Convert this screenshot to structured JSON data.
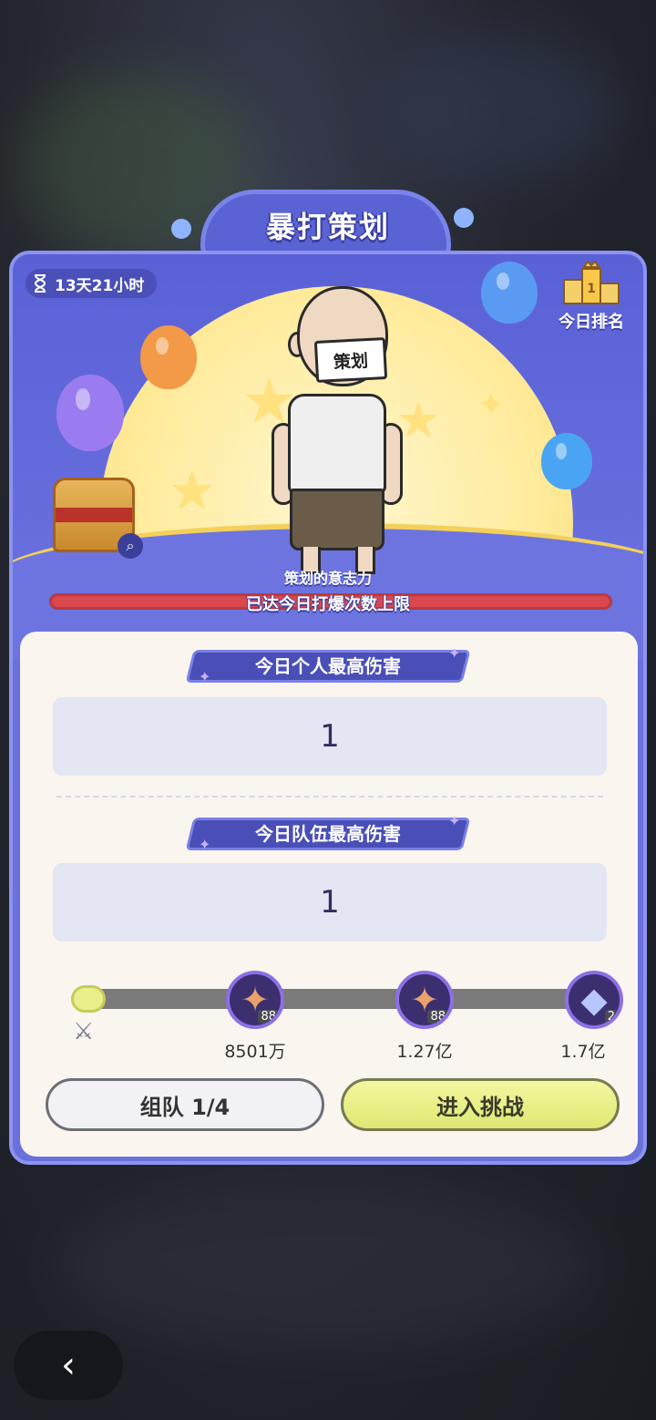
{
  "title": "暴打策划",
  "timer": "13天21小时",
  "rank_label": "今日排名",
  "boss": {
    "sign": "策划",
    "will_label": "策划的意志力",
    "status": "已达今日打爆次数上限"
  },
  "personal": {
    "label": "今日个人最高伤害",
    "value": "1"
  },
  "team": {
    "label": "今日队伍最高伤害",
    "value": "1"
  },
  "rewards": [
    {
      "icon": "gem-icon",
      "count": "88",
      "threshold": "8501万"
    },
    {
      "icon": "gem-icon",
      "count": "88",
      "threshold": "1.27亿"
    },
    {
      "icon": "ticket-icon",
      "count": "2",
      "threshold": "1.7亿"
    }
  ],
  "progress": 0.02,
  "buttons": {
    "team": "组队 1/4",
    "enter": "进入挑战"
  },
  "colors": {
    "primary": "#6a70dc",
    "hp": "#d9474f",
    "accent": "#dfe872"
  }
}
